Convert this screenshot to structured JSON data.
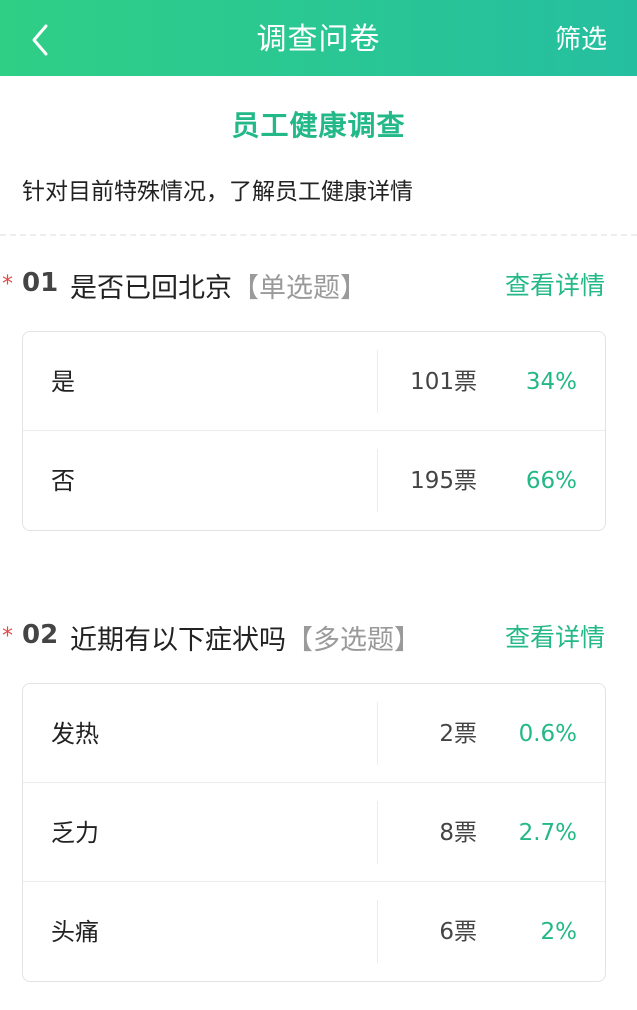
{
  "header": {
    "title": "调查问卷",
    "filter_label": "筛选",
    "back_icon": "chevron-left-icon"
  },
  "survey": {
    "title": "员工健康调查",
    "description": "针对目前特殊情况，了解员工健康详情"
  },
  "colors": {
    "accent": "#23b887",
    "header_start": "#2fcf86",
    "header_end": "#25bfa0",
    "required_star": "#e04a4a"
  },
  "questions": [
    {
      "number": "01",
      "required_mark": "*",
      "text": "是否已回北京",
      "type": "【单选题】",
      "detail_label": "查看详情",
      "options": [
        {
          "label": "是",
          "votes": "101票",
          "percent": "34%"
        },
        {
          "label": "否",
          "votes": "195票",
          "percent": "66%"
        }
      ]
    },
    {
      "number": "02",
      "required_mark": "*",
      "text": "近期有以下症状吗",
      "type": "【多选题】",
      "detail_label": "查看详情",
      "options": [
        {
          "label": "发热",
          "votes": "2票",
          "percent": "0.6%"
        },
        {
          "label": "乏力",
          "votes": "8票",
          "percent": "2.7%"
        },
        {
          "label": "头痛",
          "votes": "6票",
          "percent": "2%"
        }
      ]
    }
  ]
}
